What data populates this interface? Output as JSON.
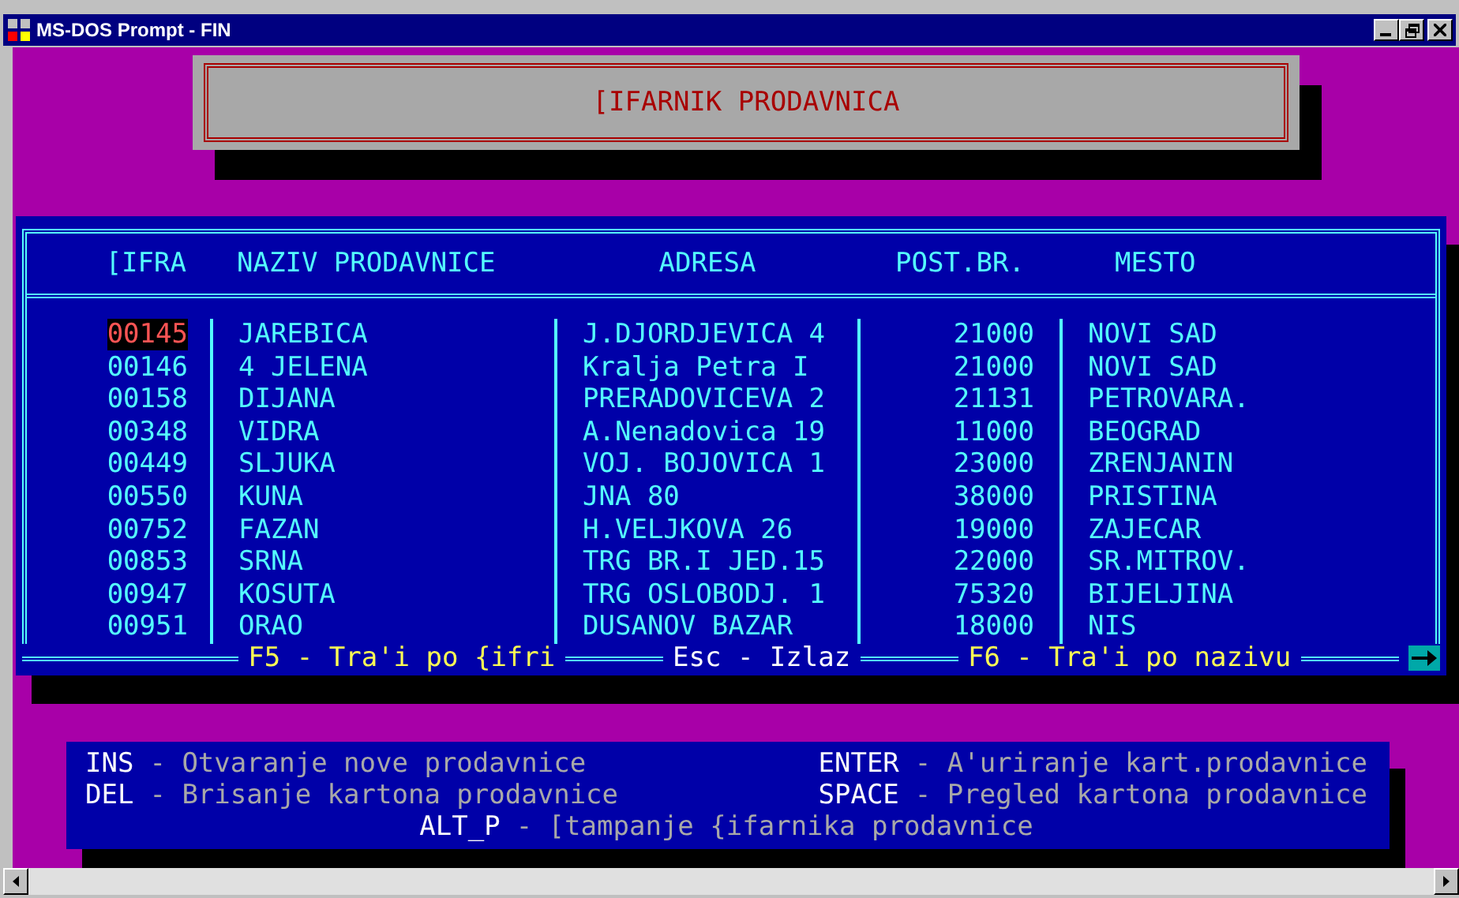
{
  "window": {
    "title": "MS-DOS Prompt - FIN"
  },
  "header": {
    "title": "[IFARNIK PRODAVNICA"
  },
  "table": {
    "columns": [
      "[IFRA",
      "NAZIV PRODAVNICE",
      "ADRESA",
      "POST.BR.",
      "MESTO"
    ],
    "rows": [
      {
        "selected": true,
        "cells": [
          "00145",
          "JAREBICA",
          "J.DJORDJEVICA 4",
          "21000",
          "NOVI SAD"
        ]
      },
      {
        "selected": false,
        "cells": [
          "00146",
          "4 JELENA",
          "Kralja Petra I",
          "21000",
          "NOVI SAD"
        ]
      },
      {
        "selected": false,
        "cells": [
          "00158",
          "DIJANA",
          "PRERADOVICEVA 2",
          "21131",
          "PETROVARA."
        ]
      },
      {
        "selected": false,
        "cells": [
          "00348",
          "VIDRA",
          "A.Nenadovica 19",
          "11000",
          "BEOGRAD"
        ]
      },
      {
        "selected": false,
        "cells": [
          "00449",
          "SLJUKA",
          "VOJ. BOJOVICA 1",
          "23000",
          "ZRENJANIN"
        ]
      },
      {
        "selected": false,
        "cells": [
          "00550",
          "KUNA",
          "JNA 80",
          "38000",
          "PRISTINA"
        ]
      },
      {
        "selected": false,
        "cells": [
          "00752",
          "FAZAN",
          "H.VELJKOVA 26",
          "19000",
          "ZAJECAR"
        ]
      },
      {
        "selected": false,
        "cells": [
          "00853",
          "SRNA",
          "TRG BR.I JED.15",
          "22000",
          "SR.MITROV."
        ]
      },
      {
        "selected": false,
        "cells": [
          "00947",
          "KOSUTA",
          "TRG OSLOBODJ. 1",
          "75320",
          "BIJELJINA"
        ]
      },
      {
        "selected": false,
        "cells": [
          "00951",
          "ORAO",
          "DUSANOV BAZAR",
          "18000",
          "NIS"
        ]
      }
    ],
    "footer": [
      {
        "label": "F5 - Tra'i po {ifri",
        "color": "#fcfc54"
      },
      {
        "label": "Esc - Izlaz",
        "color": "#fcfcfc"
      },
      {
        "label": "F6 - Tra'i po nazivu",
        "color": "#fcfc54"
      }
    ]
  },
  "help": {
    "rows": [
      [
        {
          "key": "INS",
          "text": "- Otvaranje nove prodavnice"
        },
        {
          "key": "ENTER",
          "text": "- A'uriranje kart.prodavnice"
        }
      ],
      [
        {
          "key": "DEL",
          "text": "- Brisanje kartona prodavnice"
        },
        {
          "key": "SPACE",
          "text": "- Pregled kartona prodavnice"
        }
      ],
      [
        {
          "key": "ALT_P",
          "text": "- [tampanje {ifarnika prodavnice"
        }
      ]
    ]
  }
}
